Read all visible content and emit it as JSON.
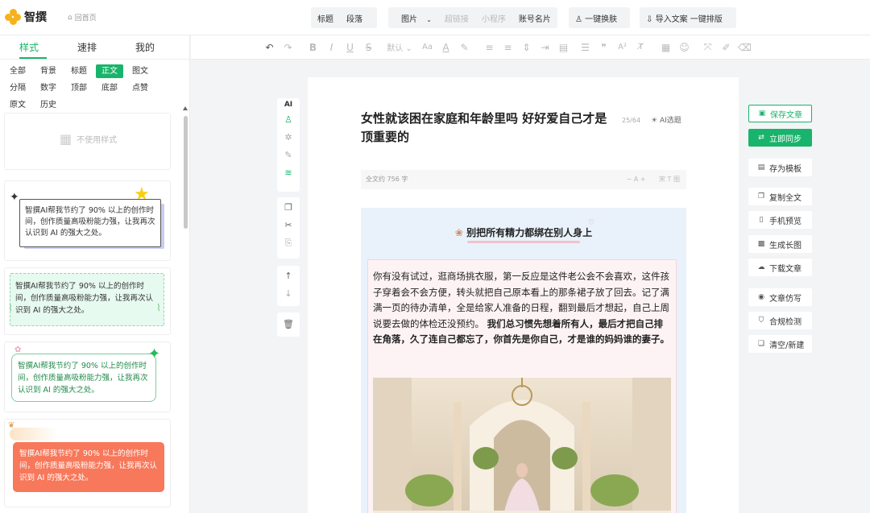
{
  "app": {
    "name": "智撰",
    "home_link": "回首页"
  },
  "top_toolbar": {
    "group1": [
      "标题",
      "段落"
    ],
    "group2": {
      "image": "图片",
      "hyperlink": "超链接",
      "mini_program": "小程序",
      "account_card": "账号名片"
    },
    "one_click_skin": "一键换肤",
    "import_layout": "导入文案 一键排版"
  },
  "left_panel": {
    "tabs": [
      "样式",
      "速排",
      "我的"
    ],
    "active_tab": 0,
    "categories": [
      "全部",
      "背景",
      "标题",
      "正文",
      "图文",
      "分隔",
      "数字",
      "顶部",
      "底部",
      "点赞",
      "原文",
      "历史"
    ],
    "active_category": 3,
    "no_style_label": "不使用样式",
    "template_texts": [
      "智撰AI帮我节约了 90% 以上的创作时间，创作质量高吸粉能力强，让我再次认识到 AI 的强大之处。",
      "智撰AI帮我节约了 90% 以上的创作时间，创作质量高吸粉能力强，让我再次认识到 AI 的强大之处。",
      "智撰AI帮我节约了 90% 以上的创作时间，创作质量高吸粉能力强，让我再次认识到 AI 的强大之处。",
      "智撰AI帮我节约了 90% 以上的创作时间，创作质量高吸粉能力强，让我再次认识到 AI 的强大之处。"
    ]
  },
  "format_toolbar": {
    "font_default": "默认"
  },
  "side_tools": {
    "ai": "AI"
  },
  "editor": {
    "title": "女性就该困在家庭和年龄里吗 好好爱自己才是顶重要的",
    "title_counter": "25/64",
    "ai_title": "AI选题",
    "word_count": "全文约 756 字",
    "font_controls": "−  A  +",
    "right_controls": "宋  T  图",
    "heading": "别把所有精力都绑在别人身上",
    "paragraph_plain": "你有没有试过，逛商场挑衣服，第一反应是这件老公会不会喜欢，这件孩子穿着会不会方便，转头就把自己原本看上的那条裙子放了回去。记了满满一页的待办清单，全是给家人准备的日程，翻到最后才想起，自己上周说要去做的体检还没预约。",
    "paragraph_bold": "我们总习惯先想着所有人，最后才把自己排在角落，久了连自己都忘了，你首先是你自己，才是谁的妈妈谁的妻子。"
  },
  "right_actions": {
    "save": "保存文章",
    "sync": "立即同步",
    "save_template": "存为模板",
    "copy_all": "复制全文",
    "mobile_preview": "手机预览",
    "long_image": "生成长图",
    "download": "下载文章",
    "imitate": "文章仿写",
    "compliance": "合规检测",
    "clear": "清空/新建"
  },
  "colors": {
    "accent": "#19b46b",
    "logo": "#f5b31b"
  }
}
